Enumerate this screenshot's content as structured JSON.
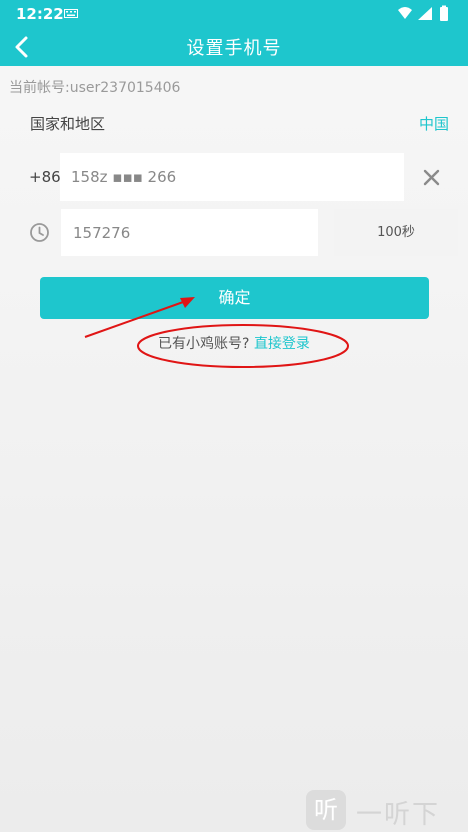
{
  "status_bar": {
    "time": "12:22"
  },
  "header": {
    "title": "设置手机号"
  },
  "account": {
    "label": "当前帐号:user237015406"
  },
  "region": {
    "label": "国家和地区",
    "value": "中国"
  },
  "phone": {
    "country_code": "+86",
    "value": "158z ▪▪▪ 266"
  },
  "verify": {
    "code_value": "157276",
    "countdown": "100秒"
  },
  "actions": {
    "confirm": "确定",
    "have_account": "已有小鸡账号?",
    "direct_login": "直接登录"
  },
  "watermark": {
    "text": "一听下载",
    "logo_char": "听"
  },
  "colors": {
    "accent": "#1ec6cd",
    "annotation": "#e01515"
  }
}
